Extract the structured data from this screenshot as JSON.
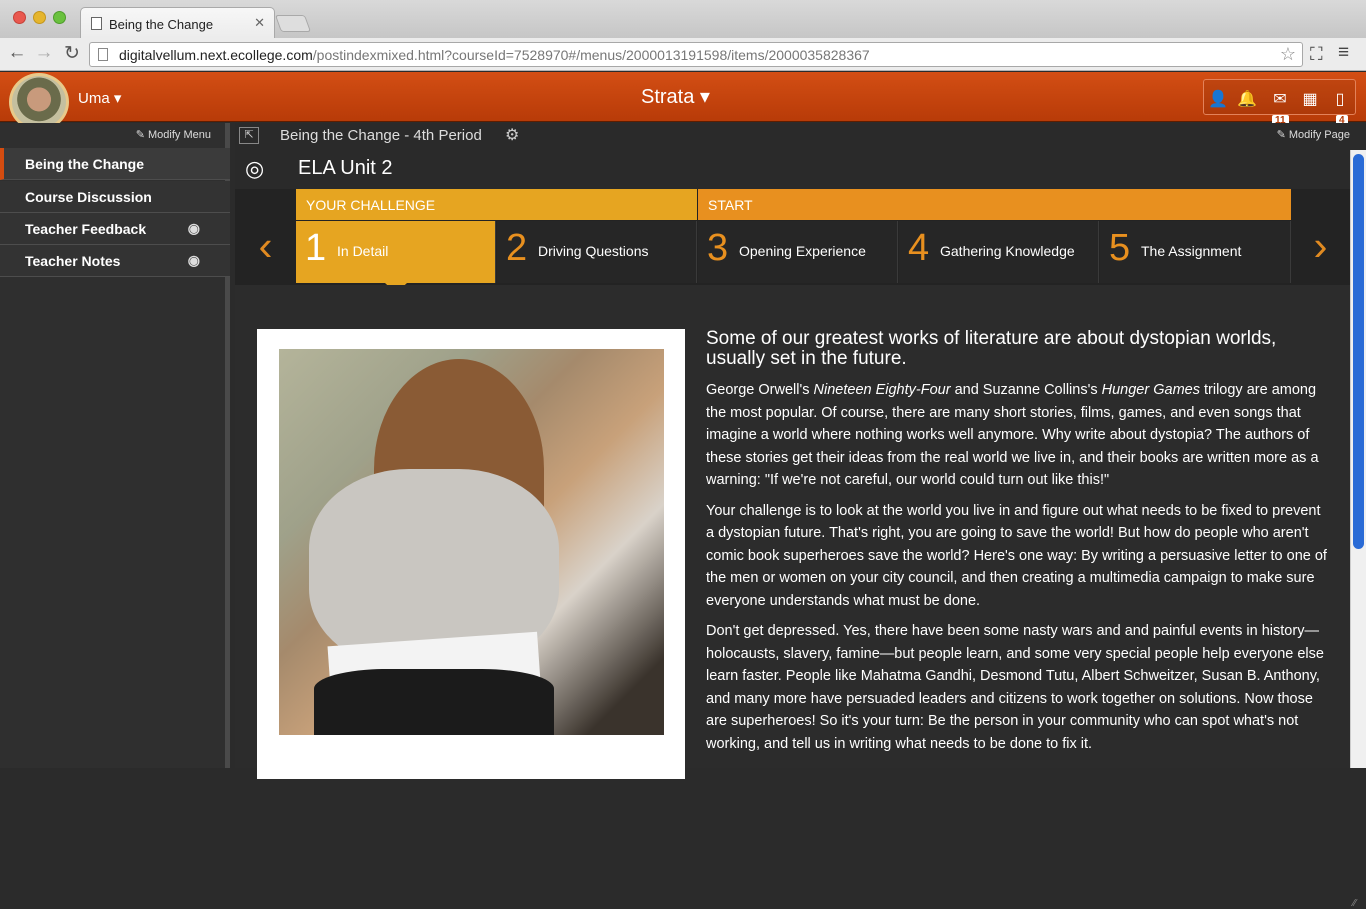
{
  "browser": {
    "tab_title": "Being the Change",
    "url_host": "digitalvellum.next.ecollege.com",
    "url_path": "/postindexmixed.html?courseId=7528970#/menus/2000013191598/items/2000035828367"
  },
  "topbar": {
    "user_name": "Uma ▾",
    "brand": "Strata ▾",
    "mail_count": "11",
    "page_count": "4"
  },
  "sidebar": {
    "modify_menu": "✎ Modify Menu",
    "items": [
      {
        "label": "Being the Change"
      },
      {
        "label": "Course Discussion"
      },
      {
        "label": "Teacher Feedback"
      },
      {
        "label": "Teacher Notes"
      }
    ]
  },
  "main": {
    "breadcrumb": "Being the Change - 4th Period",
    "modify_page": "✎ Modify Page",
    "unit_title": "ELA Unit 2",
    "section_challenge": "YOUR CHALLENGE",
    "section_start": "START",
    "steps": [
      {
        "num": "1",
        "label": "In Detail"
      },
      {
        "num": "2",
        "label": "Driving Questions"
      },
      {
        "num": "3",
        "label": "Opening Experience"
      },
      {
        "num": "4",
        "label": "Gathering Knowledge"
      },
      {
        "num": "5",
        "label": "The Assignment"
      }
    ]
  },
  "article": {
    "heading": "Some of our greatest works of literature are about dystopian worlds, usually set in the future.",
    "p1_a": "George Orwell's ",
    "p1_book1": "Nineteen Eighty-Four",
    "p1_b": " and Suzanne Collins's ",
    "p1_book2": "Hunger Games",
    "p1_c": " trilogy are among the most popular. Of course, there are many short stories, films, games, and even songs that imagine a world where nothing works well anymore. Why write about dystopia? The authors of these stories get their ideas from the real world we live in, and their books are written more as a warning: \"If we're not careful, our world could turn out like this!\"",
    "p2": "Your challenge is to look at the world you live in and figure out what needs to be fixed to prevent a dystopian future. That's right, you are going to save the world! But how do people who aren't comic book superheroes save the world? Here's one way: By writing a persuasive letter to one of the men or women on your city council, and then creating a multimedia campaign to make sure everyone understands what must be done.",
    "p3": "Don't get depressed. Yes, there have been some nasty wars and and painful events in history—holocausts, slavery, famine—but people learn, and some very special people help everyone else learn faster. People like Mahatma Gandhi, Desmond Tutu, Albert Schweitzer, Susan B. Anthony, and many more have persuaded leaders and citizens to work together on solutions. Now those are superheroes! So it's your turn: Be the person in your community who can spot what's not working, and tell us in writing what needs to be done to fix it."
  }
}
